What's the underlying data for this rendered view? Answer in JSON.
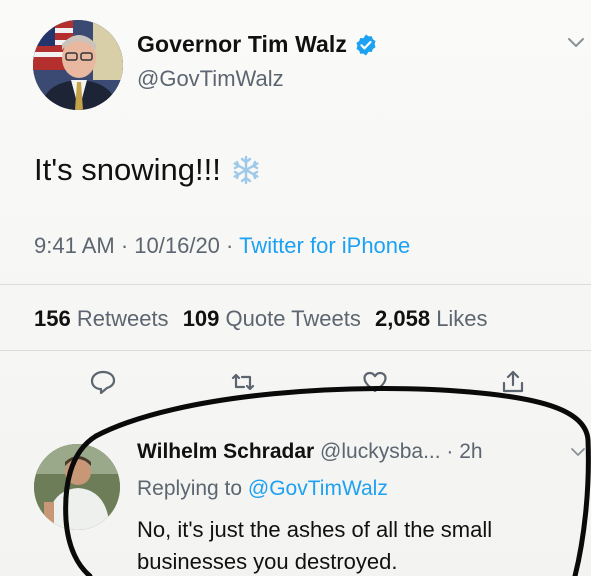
{
  "tweet": {
    "display_name": "Governor Tim Walz",
    "handle": "@GovTimWalz",
    "text": "It's snowing!!!",
    "time": "9:41 AM",
    "date": "10/16/20",
    "source": "Twitter for iPhone",
    "separator": " · ",
    "stats": {
      "retweets_count": "156",
      "retweets_label": "Retweets",
      "quote_count": "109",
      "quote_label": "Quote Tweets",
      "likes_count": "2,058",
      "likes_label": "Likes"
    }
  },
  "reply": {
    "display_name": "Wilhelm Schradar",
    "handle": "@luckysba...",
    "age": "2h",
    "replying_prefix": "Replying to",
    "replying_to": "@GovTimWalz",
    "text": "No, it's just the ashes of all the small businesses you destroyed."
  },
  "icons": {
    "verified": "verified-badge-icon",
    "snowflake": "snowflake-emoji-icon",
    "reply": "comment-icon",
    "retweet": "retweet-icon",
    "like": "heart-icon",
    "share": "share-icon",
    "more": "chevron-down-icon"
  },
  "colors": {
    "link": "#1da1f2",
    "secondary_text": "#5d6670",
    "annotation": "#0a0a0a"
  }
}
